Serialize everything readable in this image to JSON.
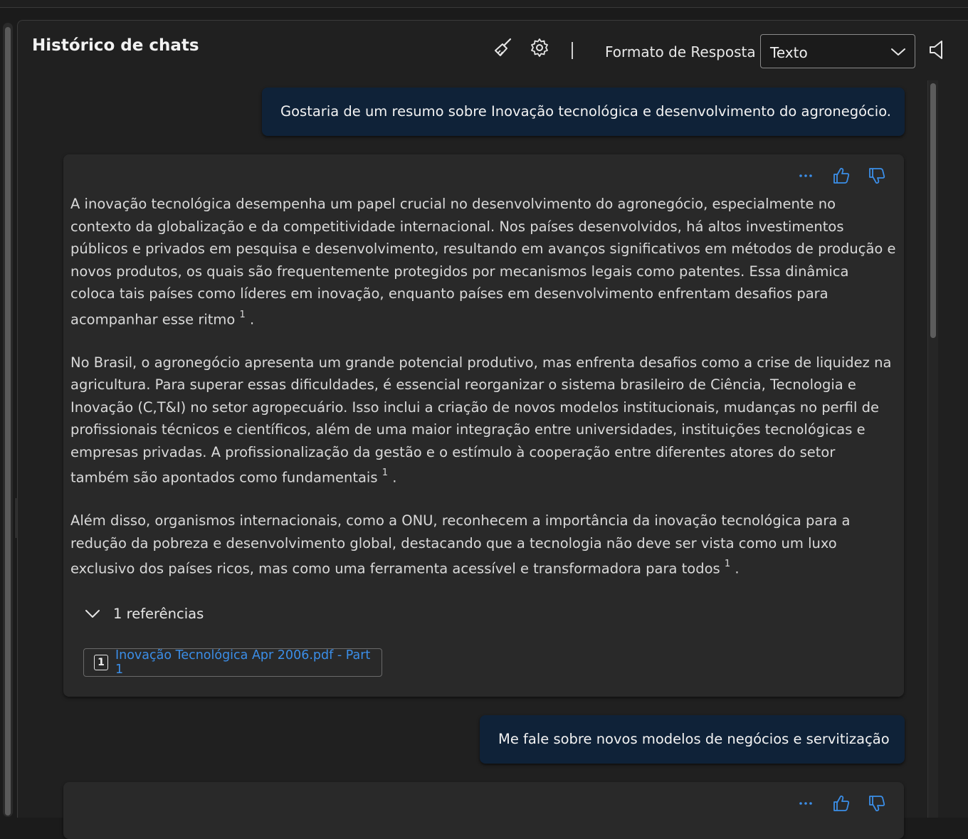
{
  "panel": {
    "title": "Histórico de chats"
  },
  "toolbar": {
    "clear_icon": "broom-icon",
    "settings_icon": "gear-icon",
    "separator": "|",
    "format_label": "Formato de Resposta",
    "format_selected": "Texto",
    "speaker_icon": "speaker-icon"
  },
  "messages": [
    {
      "role": "user",
      "text": "Gostaria de um resumo sobre Inovação tecnológica e desenvolvimento do agronegócio."
    },
    {
      "role": "assistant",
      "paragraphs": [
        {
          "text": "A inovação tecnológica desempenha um papel crucial no desenvolvimento do agronegócio, especialmente no contexto da globalização e da competitividade internacional. Nos países desenvolvidos, há altos investimentos públicos e privados em pesquisa e desenvolvimento, resultando em avanços significativos em métodos de produção e novos produtos, os quais são frequentemente protegidos por mecanismos legais como patentes. Essa dinâmica coloca tais países como líderes em inovação, enquanto países em desenvolvimento enfrentam desafios para acompanhar esse ritmo",
          "citation": "1",
          "end": "."
        },
        {
          "text": "No Brasil, o agronegócio apresenta um grande potencial produtivo, mas enfrenta desafios como a crise de liquidez na agricultura. Para superar essas dificuldades, é essencial reorganizar o sistema brasileiro de Ciência, Tecnologia e Inovação (C,T&I) no setor agropecuário. Isso inclui a criação de novos modelos institucionais, mudanças no perfil de profissionais técnicos e científicos, além de uma maior integração entre universidades, instituições tecnológicas e empresas privadas. A profissionalização da gestão e o estímulo à cooperação entre diferentes atores do setor também são apontados como fundamentais",
          "citation": "1",
          "end": "."
        },
        {
          "text": "Além disso, organismos internacionais, como a ONU, reconhecem a importância da inovação tecnológica para a redução da pobreza e desenvolvimento global, destacando que a tecnologia não deve ser vista como um luxo exclusivo dos países ricos, mas como uma ferramenta acessível e transformadora para todos",
          "citation": "1",
          "end": "."
        }
      ],
      "references_label": "1 referências",
      "references": [
        {
          "num": "1",
          "title": "Inovação Tecnológica Apr 2006.pdf - Part 1"
        }
      ],
      "actions": {
        "more": "···",
        "like_icon": "thumbs-up-icon",
        "dislike_icon": "thumbs-down-icon"
      }
    },
    {
      "role": "user",
      "text": "Me fale sobre novos modelos de negócios e servitização"
    },
    {
      "role": "assistant",
      "actions": {
        "more": "···",
        "like_icon": "thumbs-up-icon",
        "dislike_icon": "thumbs-down-icon"
      }
    }
  ],
  "colors": {
    "background": "#202020",
    "user_bubble": "#0f2238",
    "card": "#292929",
    "accent_icon": "#3b8ee8",
    "link": "#3b8ee8"
  }
}
